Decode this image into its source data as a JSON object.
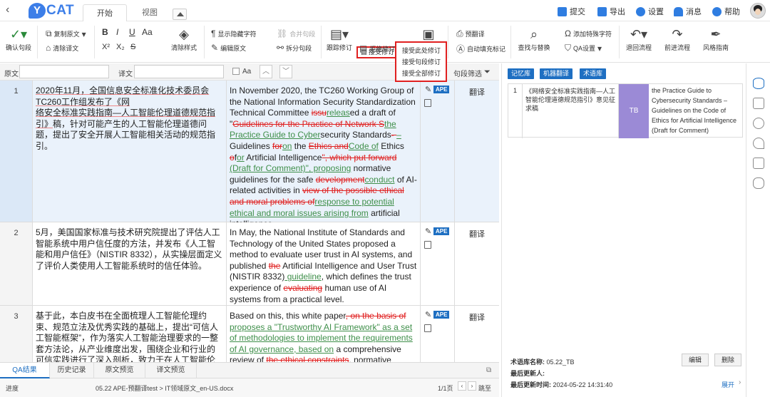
{
  "app": {
    "logo_text": "CAT",
    "logo_letter": "Y",
    "back_glyph": "‹"
  },
  "tabs": [
    {
      "label": "开始"
    },
    {
      "label": "视图"
    }
  ],
  "top_actions": [
    {
      "label": "提交",
      "icon": "submit-icon"
    },
    {
      "label": "导出",
      "icon": "export-icon"
    },
    {
      "label": "设置",
      "icon": "gear-icon"
    },
    {
      "label": "消息",
      "icon": "bell-icon"
    },
    {
      "label": "帮助",
      "icon": "help-icon"
    }
  ],
  "ribbon": {
    "confirm": "确认句段",
    "copy_source": "复制原文",
    "clear_target": "清除译文",
    "clear_style": "清除样式",
    "show_hidden": "显示隐藏字符",
    "edit_source": "编辑原文",
    "merge": "合并句段",
    "split": "拆分句段",
    "track_changes": "跟踪修订",
    "accept": "接受修订",
    "reject": "拒绝修订",
    "pretranslate": "预翻译",
    "autofill": "自动填充标记",
    "find_replace": "查找与替换",
    "add_special": "添加特殊字符",
    "qa_settings": "QA设置",
    "return_flow": "退回流程",
    "forward_flow": "前进流程",
    "style_guide": "风格指南",
    "accept_menu": [
      "接受此处修订",
      "接受句段修订",
      "接受全部修订"
    ],
    "bold": "B",
    "italic": "I",
    "underline": "U",
    "font_size": "Aa",
    "superscript": "X²",
    "subscript": "X₂",
    "strike": "S"
  },
  "filter": {
    "source_label": "原文",
    "target_label": "译文",
    "case_label": "Aa",
    "segment_filter": "句段筛选"
  },
  "rows": [
    {
      "num": "1",
      "status": "翻译",
      "badge": "APE",
      "source_a": "2020年11月，全国信息安全标准化技术委员会TC260工作组发布了《网",
      "source_b": "络安全标准实践指南—人工智能伦理道德规范指引》",
      "source_c": "稿，针对可能产生的人工智能伦理道德问题，提出了安全开展人工智能相关活动的规范指引。",
      "t1": "In November 2020, the TC260 Working Group of the National Information Security Standardization Technical Committee ",
      "t2": "issu",
      "t3": "releas",
      "t4": "ed a draft of ",
      "t5": "\"",
      "t6": "Guidelines for the Practice of Network S",
      "t7": "the Practice Guide to Cyber",
      "t8": "security Standards",
      "t9": "- ",
      "t10": "– ",
      "t11": "Guidelines ",
      "t12": "for",
      "t13": "on",
      "t14": " the ",
      "t15": "Ethics and",
      "t16": "Code of",
      "t17": " Ethics ",
      "t18": "o",
      "t19": "f",
      "t20": "or",
      "t21": " Artificial Intelligence",
      "t22": "\", which put forward",
      "t23": " (Draft for Comment)\", proposing",
      "t24": " normative guidelines for the safe ",
      "t25": "development",
      "t26": "conduct",
      "t27": " of AI-related activities in ",
      "t28": "view of the possible ethical and moral problems ",
      "t29": "of",
      "t30": "response to potential ethical and moral issues arising from",
      "t31": " artificial intelligence."
    },
    {
      "num": "2",
      "status": "翻译",
      "badge": "APE",
      "source": "5月，美国国家标准与技术研究院提出了评估人工智能系统中用户信任度的方法，并发布《人工智能和用户信任》（NISTIR 8332），从实操层面定义了评价人类使用人工智能系统时的信任体验。",
      "t1": "In May, the National Institute of Standards and Technology of the United States proposed a method to evaluate user trust in AI systems, and published ",
      "t2": "the",
      "t3": " Artificial Intelligence and User Trust (NISTIR 8332)",
      "t4": " guideline",
      "t5": ", which defines the trust experience of ",
      "t6": "evaluating",
      "t7": " human use of AI systems from a practical level."
    },
    {
      "num": "3",
      "status": "翻译",
      "badge": "APE",
      "source": "基于此，本白皮书在全面梳理人工智能伦理约束、规范立法及优秀实践的基础上，提出“可信人工智能框架”，作为落实人工智能治理要求的一整套方法论，从产业维度出发，围绕企业和行业的可信实践进行了深入剖析，致力于在人工智能伦理和产业",
      "t1": "Based on this, this white paper",
      "t2": ", on the basis of",
      "t3": " proposes a \"Trustworthy AI Framework\" as a set of methodologies to implement the requirements of AI governance, based on",
      "t4": " a comprehensive review of ",
      "t5": "the ethical constraints",
      "t6": ", normative legislation, and"
    }
  ],
  "bottom_tabs": [
    "QA结果",
    "历史记录",
    "原文预览",
    "译文预览"
  ],
  "statusbar": {
    "progress_label": "进度",
    "file_info": "05.22 APE-预翻译test > IT领域原文_en-US.docx",
    "page": "1/1页",
    "goto": "跳至"
  },
  "right_panel": {
    "tabs": [
      "记忆库",
      "机器翻译",
      "术语库"
    ],
    "entry": {
      "num": "1",
      "source": "《网络安全标准实践指南—人工智能伦理道德规范指引》意见征求稿",
      "badge": "TB",
      "target": "the Practice Guide to Cybersecurity Standards – Guidelines on the Code of Ethics for Artificial Intelligence (Draft for Comment)"
    },
    "tb_name_label": "术语库名称:",
    "tb_name": "05.22_TB",
    "updater_label": "最后更新人:",
    "updater": "",
    "updated_label": "最后更新时间:",
    "updated": "2024-05-22 14:31:40",
    "edit": "编辑",
    "delete": "删除",
    "expand": "展开"
  },
  "colors": {
    "accent": "#1e6fc2",
    "deleted": "#e02020",
    "inserted": "#3f8f4a",
    "tb_badge": "#9b8ad6"
  }
}
